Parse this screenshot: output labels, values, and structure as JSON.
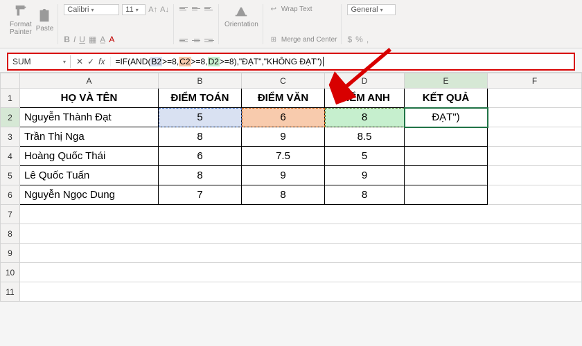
{
  "ribbon": {
    "format_painter": "Format\nPainter",
    "paste": "Paste",
    "font_name": "Calibri",
    "font_size": "11",
    "orientation": "Orientation",
    "wrap_text": "Wrap Text",
    "merge_center": "Merge and Center",
    "number_format": "General"
  },
  "namebox": "SUM",
  "formula_parts": {
    "p1": "=IF(AND(",
    "b2": "B2",
    "p2": ">=8,",
    "c2": "C2",
    "p3": ">=8,",
    "d2": "D2",
    "p4": ">=8),\"ĐẠT\",\"KHÔNG ĐẠT\")"
  },
  "columns": [
    "A",
    "B",
    "C",
    "D",
    "E",
    "F"
  ],
  "rows": [
    "1",
    "2",
    "3",
    "4",
    "5",
    "6",
    "7",
    "8",
    "9",
    "10",
    "11"
  ],
  "headers": {
    "a": "HỌ VÀ TÊN",
    "b": "ĐIỂM TOÁN",
    "c": "ĐIỂM VĂN",
    "d": "ĐIỂM ANH",
    "e": "KẾT QUẢ"
  },
  "table": [
    {
      "a": "Nguyễn Thành Đạt",
      "b": "5",
      "c": "6",
      "d": "8",
      "e": "ĐẠT\")"
    },
    {
      "a": "Trần Thị Nga",
      "b": "8",
      "c": "9",
      "d": "8.5",
      "e": ""
    },
    {
      "a": "Hoàng Quốc Thái",
      "b": "6",
      "c": "7.5",
      "d": "5",
      "e": ""
    },
    {
      "a": "Lê Quốc Tuấn",
      "b": "8",
      "c": "9",
      "d": "9",
      "e": ""
    },
    {
      "a": "Nguyễn Ngọc Dung",
      "b": "7",
      "c": "8",
      "d": "8",
      "e": ""
    }
  ],
  "chart_data": {
    "type": "table",
    "title": "KẾT QUẢ",
    "columns": [
      "HỌ VÀ TÊN",
      "ĐIỂM TOÁN",
      "ĐIỂM VĂN",
      "ĐIỂM ANH",
      "KẾT QUẢ"
    ],
    "rows": [
      [
        "Nguyễn Thành Đạt",
        5,
        6,
        8,
        "ĐẠT\")"
      ],
      [
        "Trần Thị Nga",
        8,
        9,
        8.5,
        ""
      ],
      [
        "Hoàng Quốc Thái",
        6,
        7.5,
        5,
        ""
      ],
      [
        "Lê Quốc Tuấn",
        8,
        9,
        9,
        ""
      ],
      [
        "Nguyễn Ngọc Dung",
        7,
        8,
        8,
        ""
      ]
    ],
    "formula": "=IF(AND(B2>=8,C2>=8,D2>=8),\"ĐẠT\",\"KHÔNG ĐẠT\")",
    "active_cell": "E2"
  }
}
